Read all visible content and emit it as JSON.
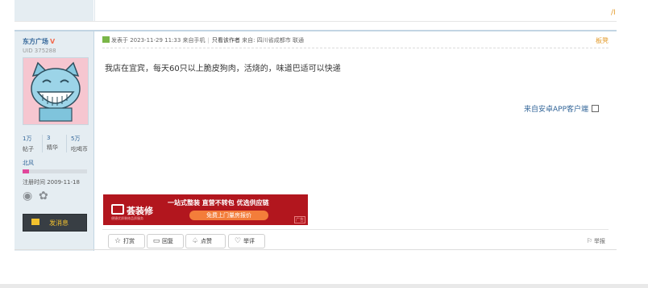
{
  "top": {
    "corner_mark": "/I"
  },
  "author": {
    "name": "东方广场",
    "verified_mark": "V",
    "uid": "UID 375288",
    "stats": [
      {
        "value": "1万",
        "label": "帖子"
      },
      {
        "value": "3",
        "label": "精华"
      },
      {
        "value": "5万",
        "label": "吃喝币"
      }
    ],
    "rank": "北风",
    "rank_progress": 0.1,
    "register": "注册时间  2009-11-18",
    "message_button": "发消息"
  },
  "post": {
    "posted_at": "发表于 2023-11-29 11:33 来自手机",
    "only_author": "只看该作者",
    "source_label": "来自:",
    "source": "四川省成都市 联通",
    "floor": "板凳",
    "content": "我店在宜宾，每天60只以上脆皮狗肉，活烧的，味道巴适可以快递",
    "from_app": "来自安卓APP客户端"
  },
  "ad": {
    "logo": "荟装修",
    "subtext": "便捷优质装修品质服务",
    "slogan": "一站式整装  直营不转包  优选供应链",
    "button": "免费上门量房报价",
    "tag": "广告"
  },
  "actions": [
    {
      "label": "打赏",
      "icon": "☆"
    },
    {
      "label": "回复",
      "icon": "▭"
    },
    {
      "label": "点赞",
      "icon": "♤"
    },
    {
      "label": "举评",
      "icon": "♡"
    }
  ],
  "report": "举报",
  "colors": {
    "accent_blue": "#336699",
    "side_bg": "#e5edf2",
    "ad_red": "#b2161e",
    "floor_orange": "#e39b2b"
  }
}
